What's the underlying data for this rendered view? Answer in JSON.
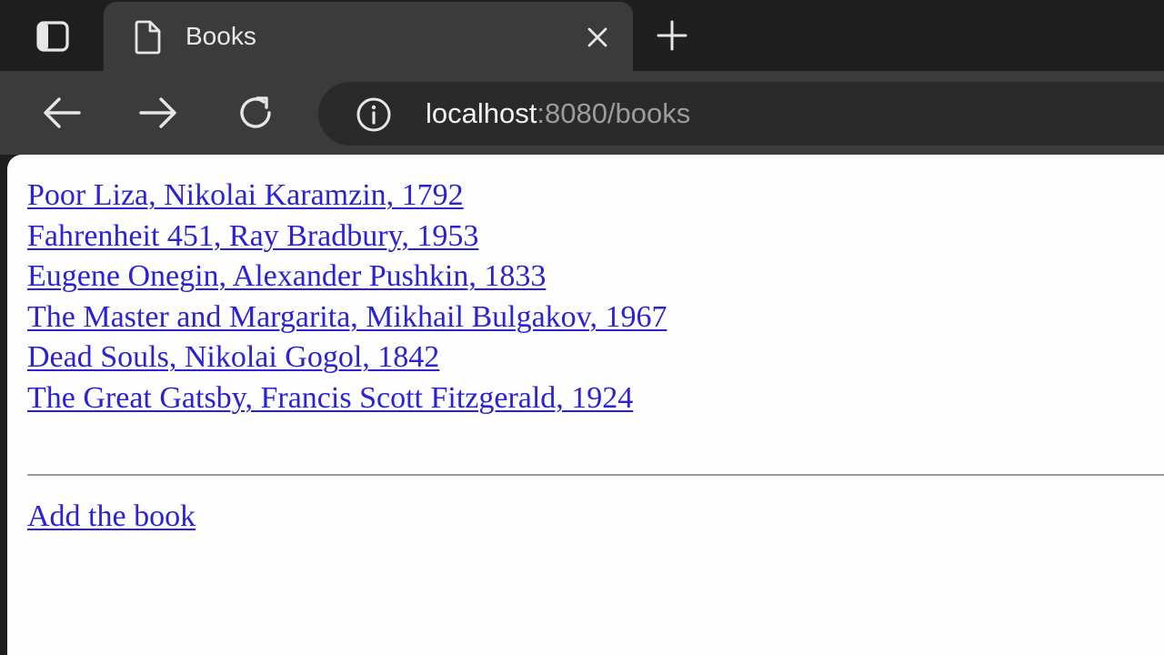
{
  "browser": {
    "tab": {
      "title": "Books"
    },
    "address": {
      "host": "localhost",
      "rest": ":8080/books"
    },
    "icons": {
      "sidebar": "sidebar-icon",
      "page": "page-icon",
      "close": "close-icon",
      "new_tab": "plus-icon",
      "back": "back-arrow-icon",
      "forward": "forward-arrow-icon",
      "reload": "reload-icon",
      "info": "info-icon"
    },
    "colors": {
      "chrome_dark": "#1f1f1f",
      "chrome_mid": "#3b3b3b",
      "address_bg": "#2a2a2a",
      "link": "#2b22d6",
      "page_bg": "#fefefe"
    }
  },
  "page": {
    "books": [
      "Poor Liza, Nikolai Karamzin, 1792",
      "Fahrenheit 451, Ray Bradbury, 1953",
      "Eugene Onegin, Alexander Pushkin, 1833",
      "The Master and Margarita, Mikhail Bulgakov, 1967",
      "Dead Souls, Nikolai Gogol, 1842",
      "The Great Gatsby, Francis Scott Fitzgerald, 1924"
    ],
    "add_link": "Add the book"
  }
}
